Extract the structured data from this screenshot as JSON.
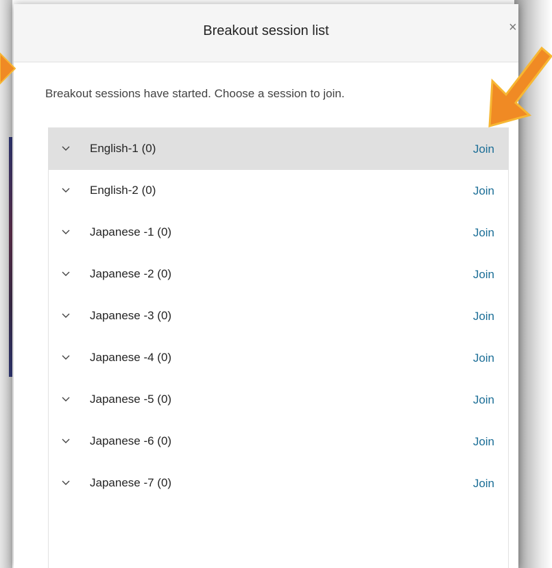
{
  "dialog": {
    "title": "Breakout session list",
    "close_glyph": "×",
    "instructions": "Breakout sessions have started. Choose a session to join."
  },
  "sessions": [
    {
      "name": "English-1 (0)",
      "join": "Join",
      "selected": true
    },
    {
      "name": "English-2 (0)",
      "join": "Join"
    },
    {
      "name": "Japanese -1 (0)",
      "join": "Join"
    },
    {
      "name": "Japanese -2 (0)",
      "join": "Join"
    },
    {
      "name": "Japanese -3 (0)",
      "join": "Join"
    },
    {
      "name": "Japanese -4 (0)",
      "join": "Join"
    },
    {
      "name": "Japanese -5 (0)",
      "join": "Join"
    },
    {
      "name": "Japanese -6 (0)",
      "join": "Join"
    },
    {
      "name": "Japanese -7 (0)",
      "join": "Join"
    }
  ],
  "colors": {
    "accent_link": "#1a6d96",
    "annotation_arrow": "#f08a24",
    "annotation_arrow_border": "#f7b733",
    "selected_row": "#e0e0e0"
  },
  "icons": {
    "row_toggle": "chevron-down-icon",
    "close": "close-icon",
    "annotation": "arrow-icon"
  }
}
